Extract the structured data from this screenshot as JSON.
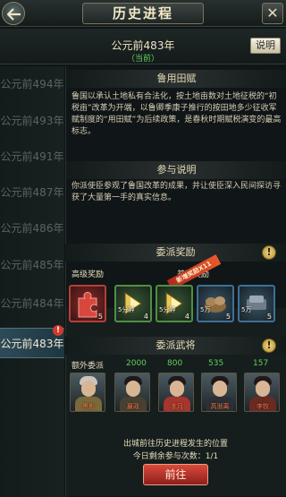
{
  "header": {
    "title": "历史进程",
    "close_label": "✕"
  },
  "era": {
    "current": "公元前483年",
    "status": "（当前）",
    "explain_label": "说明"
  },
  "timeline": {
    "items": [
      {
        "label": "公元前494年",
        "active": false
      },
      {
        "label": "公元前493年",
        "active": false
      },
      {
        "label": "公元前491年",
        "active": false
      },
      {
        "label": "公元前487年",
        "active": false
      },
      {
        "label": "公元前486年",
        "active": false
      },
      {
        "label": "公元前485年",
        "active": false
      },
      {
        "label": "公元前484年",
        "active": false
      },
      {
        "label": "公元前483年",
        "active": true
      }
    ],
    "alert_mark": "!"
  },
  "event": {
    "title": "鲁用田赋",
    "description": "鲁国以承认土地私有合法化，按土地亩数对土地征税的“初税亩”改革为开端，以鲁卿季康子推行的按田地多少征收军赋制度的“用田赋”为后续政策，是春秋时期赋税演变的最高标志。"
  },
  "participation": {
    "title": "参与说明",
    "description": "你派使臣参观了鲁国改革的成果，并让使臣深入民间探访寻获了大量第一手的真实信息。"
  },
  "rewards": {
    "title": "委派奖励",
    "alert_mark": "!",
    "senior_label": "高级奖励",
    "normal_label": "普通奖励",
    "ribbon_label": "新增奖励X11",
    "items": [
      {
        "icon": "red-puzzle-icon",
        "tag": "",
        "count": "5"
      },
      {
        "icon": "speedup-icon",
        "tag": "5分钟",
        "count": "4"
      },
      {
        "icon": "speedup-icon",
        "tag": "5分钟",
        "count": "4"
      },
      {
        "icon": "resource-icon",
        "tag": "5万",
        "count": "5"
      },
      {
        "icon": "resource-icon",
        "tag": "5万",
        "count": "5"
      }
    ]
  },
  "generals": {
    "title": "委派武将",
    "alert_mark": "!",
    "extra_label": "额外委派",
    "values": [
      "2000",
      "800",
      "535",
      "157"
    ],
    "portraits": [
      {
        "name": "黑影"
      },
      {
        "name": "嬴政"
      },
      {
        "name": "芈月"
      },
      {
        "name": "高渐离"
      },
      {
        "name": "李牧"
      }
    ]
  },
  "footer": {
    "line1": "出城前往历史进程发生的位置",
    "line2": "今日剩余参与次数：1/1",
    "go_label": "前往"
  },
  "colors": {
    "accent_green": "#5fd05a",
    "button_red": "#c0392b",
    "active_tab": "#2d4b57"
  }
}
